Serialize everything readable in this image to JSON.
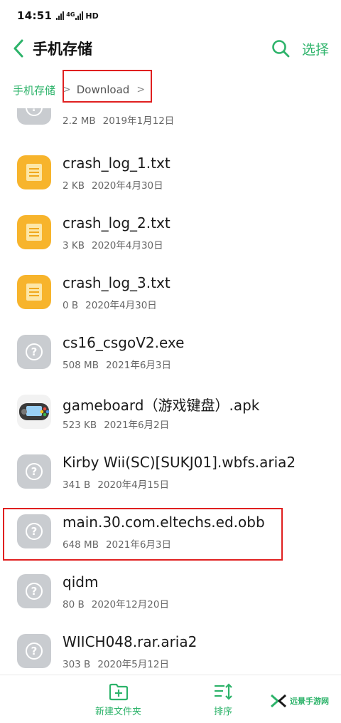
{
  "status": {
    "time": "14:51",
    "network": "4G",
    "hd": "HD"
  },
  "header": {
    "title": "手机存储",
    "select_label": "选择"
  },
  "breadcrumb": {
    "root": "手机存储",
    "sep1": ">",
    "current": "Download",
    "sep2": ">"
  },
  "files": [
    {
      "icon": "unknown-file-icon",
      "name": "",
      "size": "2.2 MB",
      "date": "2019年1月12日"
    },
    {
      "icon": "text-file-icon",
      "name": "crash_log_1.txt",
      "size": "2 KB",
      "date": "2020年4月30日"
    },
    {
      "icon": "text-file-icon",
      "name": "crash_log_2.txt",
      "size": "3 KB",
      "date": "2020年4月30日"
    },
    {
      "icon": "text-file-icon",
      "name": "crash_log_3.txt",
      "size": "0 B",
      "date": "2020年4月30日"
    },
    {
      "icon": "unknown-file-icon",
      "name": "cs16_csgoV2.exe",
      "size": "508 MB",
      "date": "2021年6月3日"
    },
    {
      "icon": "app-icon",
      "name": "gameboard（游戏键盘）.apk",
      "size": "523 KB",
      "date": "2021年6月2日"
    },
    {
      "icon": "unknown-file-icon",
      "name": "Kirby Wii(SC)[SUKJ01].wbfs.aria2",
      "size": "341 B",
      "date": "2020年4月15日"
    },
    {
      "icon": "unknown-file-icon",
      "name": "main.30.com.eltechs.ed.obb",
      "size": "648 MB",
      "date": "2021年6月3日"
    },
    {
      "icon": "unknown-file-icon",
      "name": "qidm",
      "size": "80 B",
      "date": "2020年12月20日"
    },
    {
      "icon": "unknown-file-icon",
      "name": "WIICH048.rar.aria2",
      "size": "303 B",
      "date": "2020年5月12日"
    }
  ],
  "bottom": {
    "new_folder": "新建文件夹",
    "sort": "排序"
  },
  "watermark": {
    "text": "远景手游网"
  },
  "colors": {
    "accent": "#2db36a",
    "highlight": "#e02020",
    "text_icon": "#f7b42c",
    "unknown_icon": "#c9ccd0"
  }
}
